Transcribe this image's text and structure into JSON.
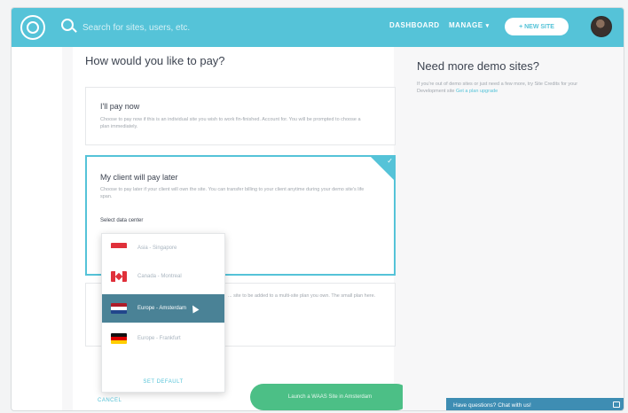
{
  "header": {
    "search_placeholder": "Search for sites, users, etc.",
    "nav_dashboard": "DASHBOARD",
    "nav_manage": "MANAGE",
    "new_site_button": "+ NEW SITE"
  },
  "main": {
    "title": "How would you like to pay?",
    "options": [
      {
        "title": "I'll pay now",
        "description": "Choose to pay now if this is an individual site you wish to work fin-finished. Account for. You will be prompted to choose a plan immediately."
      },
      {
        "title": "My client will pay later",
        "description": "Choose to pay later if your client will own the site. You can transfer billing to your client anytime during your demo site's life span.",
        "selected": true
      },
      {
        "title": "",
        "description": "... site to be added to a multi-site plan you own. The small plan here."
      }
    ],
    "datacenter_label": "Select data center",
    "datacenters": [
      {
        "label": "Asia - Singapore",
        "flag": "sg",
        "selected": false
      },
      {
        "label": "Canada - Montreal",
        "flag": "ca",
        "selected": false
      },
      {
        "label": "Europe - Amsterdam",
        "flag": "nl",
        "selected": true
      },
      {
        "label": "Europe - Frankfurt",
        "flag": "de",
        "selected": false
      }
    ],
    "datacenter_footer": "SET DEFAULT",
    "cancel": "CANCEL",
    "primary_button": "Launch a WAAS Site in Amsterdam"
  },
  "sidebar": {
    "title": "Need more demo sites?",
    "text": "If you're out of demo sites or just need a few more, try Site Credits for your Development site",
    "link": "Get a plan upgrade"
  },
  "chat": {
    "label": "Have questions? Chat with us!"
  },
  "colors": {
    "brand": "#55c3d8",
    "selected_row": "#4a8296",
    "primary_button": "#4cbf86",
    "chat_bar": "#3e8db3"
  }
}
